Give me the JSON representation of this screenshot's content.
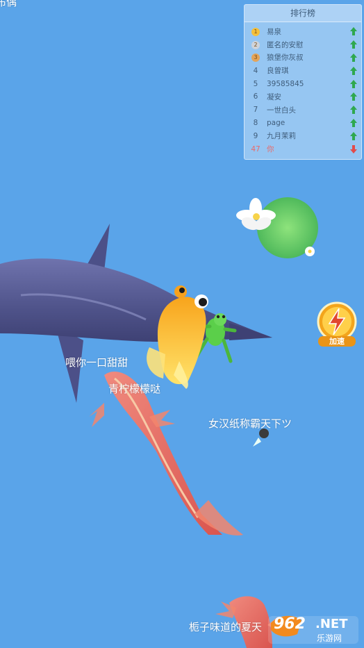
{
  "top_clipped_name": "布偶",
  "leaderboard": {
    "title": "排行榜",
    "rows": [
      {
        "rank": "1",
        "name": "易泉",
        "medal": "gold",
        "trend": "up"
      },
      {
        "rank": "2",
        "name": "匿名的安慰",
        "medal": "silver",
        "trend": "up"
      },
      {
        "rank": "3",
        "name": "狼堡你灰叔",
        "medal": "bronze",
        "trend": "up"
      },
      {
        "rank": "4",
        "name": "良曾琪",
        "medal": "",
        "trend": "up"
      },
      {
        "rank": "5",
        "name": "39585845",
        "medal": "",
        "trend": "up"
      },
      {
        "rank": "6",
        "name": "凝安",
        "medal": "",
        "trend": "up"
      },
      {
        "rank": "7",
        "name": "一世白头",
        "medal": "",
        "trend": "up"
      },
      {
        "rank": "8",
        "name": "page",
        "medal": "",
        "trend": "up"
      },
      {
        "rank": "9",
        "name": "九月茉莉",
        "medal": "",
        "trend": "up"
      },
      {
        "rank": "47",
        "name": "你",
        "medal": "",
        "trend": "down"
      }
    ]
  },
  "players": {
    "shark_name": "喂你一口甜甜",
    "koi_name": "青柠檬檬哒",
    "small_fish_name": "女汉纸称霸天下ツ",
    "bottom_name": "栀子味道的夏天"
  },
  "boost": {
    "label": "加速",
    "icon": "lightning-icon"
  },
  "watermark": {
    "brand": "962",
    "brand_suffix": ".NET",
    "site": "乐游网"
  },
  "colors": {
    "water": "#5aa4e9",
    "shark": "#5b5f97",
    "goldfish": "#f7b21e",
    "koi": "#e8716a",
    "lilypad": "#6fd46a",
    "trend_up": "#2fa84f",
    "trend_down": "#e24b4b"
  }
}
